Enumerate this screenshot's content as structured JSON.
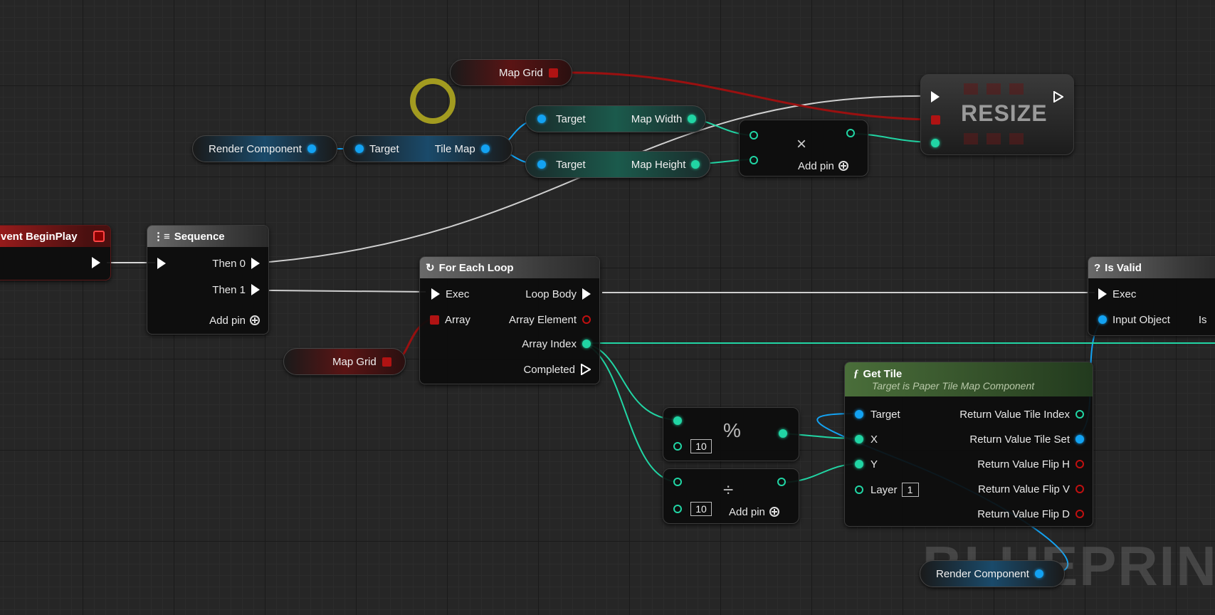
{
  "watermark": "BLUEPRINT",
  "nodes": {
    "map_grid_top": {
      "label": "Map Grid"
    },
    "render_component_left": {
      "label": "Render Component"
    },
    "get_tile_map": {
      "target": "Target",
      "output": "Tile Map"
    },
    "get_map_width": {
      "target": "Target",
      "output": "Map Width"
    },
    "get_map_height": {
      "target": "Target",
      "output": "Map Height"
    },
    "multiply": {
      "symbol": "×",
      "add_pin": "Add pin"
    },
    "resize": {
      "label": "RESIZE"
    },
    "event_begin_play": {
      "title": "vent BeginPlay"
    },
    "sequence": {
      "title": "Sequence",
      "then0": "Then 0",
      "then1": "Then 1",
      "add_pin": "Add pin"
    },
    "for_each_loop": {
      "title": "For Each Loop",
      "exec": "Exec",
      "array": "Array",
      "loop_body": "Loop Body",
      "array_element": "Array Element",
      "array_index": "Array Index",
      "completed": "Completed"
    },
    "map_grid_bottom": {
      "label": "Map Grid"
    },
    "is_valid": {
      "title": "Is Valid",
      "exec": "Exec",
      "input_object": "Input Object",
      "cut": "Is"
    },
    "modulo": {
      "symbol": "%",
      "b_value": "10"
    },
    "divide": {
      "symbol": "÷",
      "b_value": "10",
      "add_pin": "Add pin"
    },
    "get_tile": {
      "title": "Get Tile",
      "subtitle": "Target is Paper Tile Map Component",
      "target": "Target",
      "x": "X",
      "y": "Y",
      "layer": "Layer",
      "layer_value": "1",
      "outputs": [
        "Return Value Tile Index",
        "Return Value Tile Set",
        "Return Value Flip H",
        "Return Value Flip V",
        "Return Value Flip D"
      ]
    },
    "render_component_bottom": {
      "label": "Render Component"
    }
  },
  "colors": {
    "exec": "#ffffff",
    "object": "#13a2f2",
    "integer": "#21d5a4",
    "struct_array": "#b01313",
    "debug_cursor": "#b8b020"
  }
}
